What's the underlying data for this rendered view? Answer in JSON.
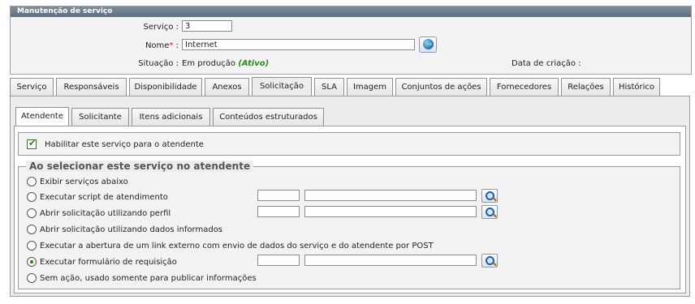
{
  "panel": {
    "title": "Manutenção de serviço",
    "servico_label": "Serviço :",
    "servico_value": "3",
    "nome_label": "Nome",
    "nome_required": "*",
    "nome_colon": " :",
    "nome_value": "Internet",
    "situacao_label": "Situação :",
    "situacao_value": "Em produção",
    "situacao_status": "(Ativo)",
    "data_criacao_label": "Data de criação :"
  },
  "tabs": [
    "Serviço",
    "Responsáveis",
    "Disponibilidade",
    "Anexos",
    "Solicitação",
    "SLA",
    "Imagem",
    "Conjuntos de ações",
    "Fornecedores",
    "Relações",
    "Histórico"
  ],
  "active_tab": "Solicitação",
  "subtabs": [
    "Atendente",
    "Solicitante",
    "Itens adicionais",
    "Conteúdos estruturados"
  ],
  "active_subtab": "Atendente",
  "enable_checkbox": {
    "label": "Habilitar este serviço para o atendente",
    "checked": true
  },
  "fieldset": {
    "legend": "Ao selecionar este serviço no atendente",
    "options": [
      "Exibir serviços abaixo",
      "Executar script de atendimento",
      "Abrir solicitação utilizando perfil",
      "Abrir solicitação utilizando dados informados",
      "Executar a abertura de um link externo com envio de dados do serviço e do atendente por POST",
      "Executar formulário de requisição",
      "Sem ação, usado somente para publicar informações"
    ],
    "selected_index": 5
  },
  "icons": {
    "globe": "globe-icon",
    "search": "search-icon",
    "check": "checkmark-icon"
  },
  "colors": {
    "title_bar": "#6b7a8a",
    "status_green": "#2a8a1f",
    "required_red": "#d11111"
  }
}
